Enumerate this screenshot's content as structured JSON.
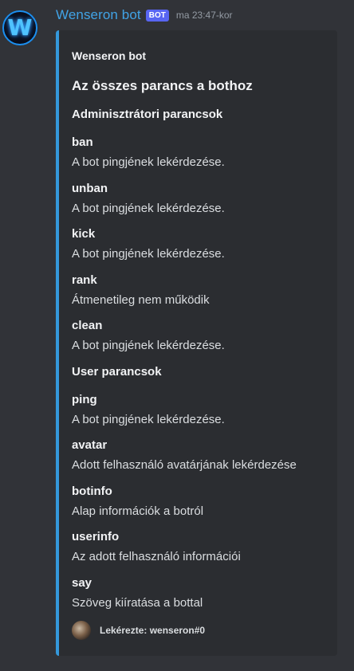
{
  "message": {
    "username": "Wenseron bot",
    "bot_tag": "BOT",
    "timestamp": "ma 23:47-kor",
    "avatar_letter": "W"
  },
  "embed": {
    "accent_color": "#3498db",
    "author": "Wenseron bot",
    "title": "Az összes parancs a bothoz",
    "sections": [
      {
        "heading": "Adminisztrátori parancsok",
        "fields": [
          {
            "name": "ban",
            "value": "A bot pingjének lekérdezése."
          },
          {
            "name": "unban",
            "value": "A bot pingjének lekérdezése."
          },
          {
            "name": "kick",
            "value": "A bot pingjének lekérdezése."
          },
          {
            "name": "rank",
            "value": "Átmenetileg nem működik"
          },
          {
            "name": "clean",
            "value": "A bot pingjének lekérdezése."
          }
        ]
      },
      {
        "heading": "User parancsok",
        "fields": [
          {
            "name": "ping",
            "value": "A bot pingjének lekérdezése."
          },
          {
            "name": "avatar",
            "value": "Adott felhasználó avatárjának lekérdezése"
          },
          {
            "name": "botinfo",
            "value": "Alap információk a botról"
          },
          {
            "name": "userinfo",
            "value": "Az adott felhasználó információi"
          },
          {
            "name": "say",
            "value": "Szöveg kiíratása a bottal"
          }
        ]
      }
    ],
    "footer": "Lekérezte: wenseron#0"
  }
}
